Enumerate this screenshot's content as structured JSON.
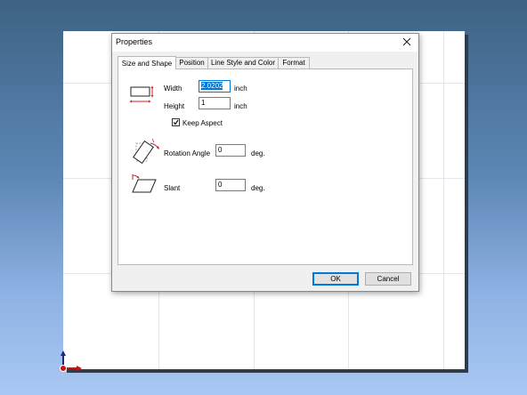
{
  "dialog": {
    "title": "Properties",
    "tabs": [
      {
        "label": "Size and Shape",
        "active": true
      },
      {
        "label": "Position",
        "active": false
      },
      {
        "label": "Line Style and Color",
        "active": false
      },
      {
        "label": "Format",
        "active": false
      }
    ],
    "size": {
      "width_label": "Width",
      "width_value": "2.0202",
      "width_unit": "inch",
      "height_label": "Height",
      "height_value": "1",
      "height_unit": "inch",
      "keep_aspect_label": "Keep Aspect",
      "keep_aspect_checked": true
    },
    "rotation": {
      "label": "Rotation Angle",
      "value": "0",
      "unit": "deg."
    },
    "slant": {
      "label": "Slant",
      "value": "0",
      "unit": "deg."
    },
    "buttons": {
      "ok": "OK",
      "cancel": "Cancel"
    }
  },
  "colors": {
    "accent": "#0078d7",
    "icon_red": "#d02020"
  },
  "icons": [
    "close-icon",
    "size-shape-icon",
    "rotation-icon",
    "slant-icon",
    "axis-origin-icon",
    "check-icon"
  ]
}
